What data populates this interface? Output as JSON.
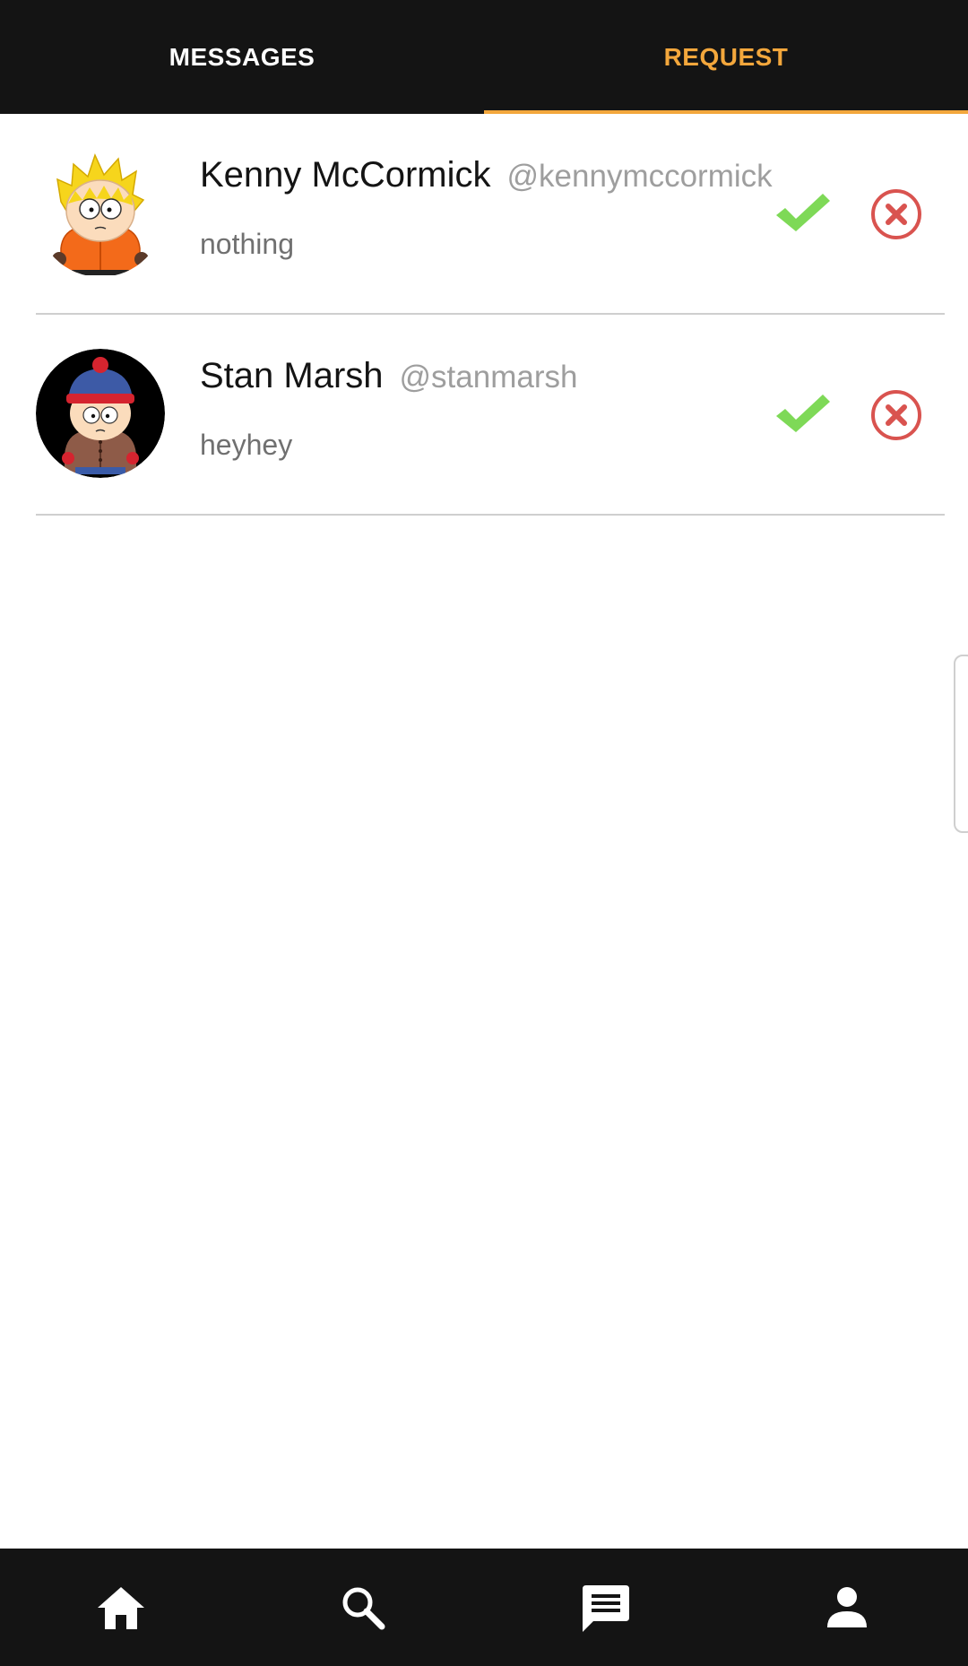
{
  "tabs": [
    {
      "label": "MESSAGES",
      "active": false
    },
    {
      "label": "REQUEST",
      "active": true
    }
  ],
  "colors": {
    "accent": "#f3a73c",
    "bar_bg": "#141414",
    "accept": "#7ed957",
    "reject": "#d9534f"
  },
  "requests": [
    {
      "name": "Kenny McCormick",
      "handle": "@kennymccormick",
      "message": "nothing"
    },
    {
      "name": "Stan Marsh",
      "handle": "@stanmarsh",
      "message": "heyhey"
    }
  ],
  "bottom_nav": {
    "icons": [
      "home-icon",
      "search-icon",
      "messages-icon",
      "profile-icon"
    ]
  }
}
